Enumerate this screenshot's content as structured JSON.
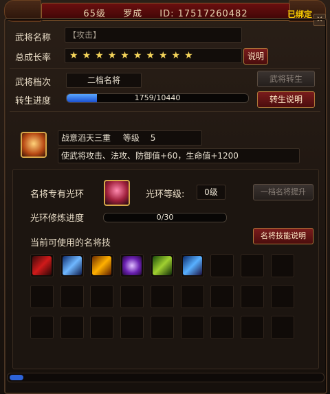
{
  "title": {
    "level": "65级",
    "name": "罗成",
    "id": "ID: 17517260482",
    "bound": "已绑定"
  },
  "general": {
    "name_label": "武将名称",
    "name_value": "【攻击】",
    "growth_label": "总成长率",
    "stars": [
      "★",
      "★",
      "★",
      "★",
      "★",
      "★",
      "★",
      "★",
      "★",
      "★"
    ],
    "growth_btn": "说明",
    "grade_label": "武将档次",
    "grade_value": "二档名将",
    "rebirth_btn": "武将转生",
    "progress_label": "转生进度",
    "progress_text": "1759/10440",
    "progress_fraction": 0.168,
    "rebirth_help_btn": "转生说明"
  },
  "skill": {
    "name": "战意滔天三重",
    "level_label": "等级",
    "level": "5",
    "desc": "使武将攻击、法攻、防御值+60，生命值+1200"
  },
  "halo": {
    "label": "名将专有光环",
    "level_label": "光环等级:",
    "level_value": "0级",
    "upgrade_btn": "一档名将提升",
    "train_label": "光环修炼进度",
    "train_text": "0/30",
    "train_fraction": 0,
    "usable_label": "当前可使用的名将技",
    "help_btn": "名将技能说明"
  },
  "slots_icons": [
    "blade-slash-icon",
    "blue-strike-icon",
    "fire-phoenix-icon",
    "purple-vortex-icon",
    "green-beast-icon",
    "blue-rain-icon"
  ],
  "colors": {
    "accent": "#7a1c1c",
    "progress": "#2d63d8",
    "stars": "#f4d45a",
    "bound": "#f2c400"
  }
}
